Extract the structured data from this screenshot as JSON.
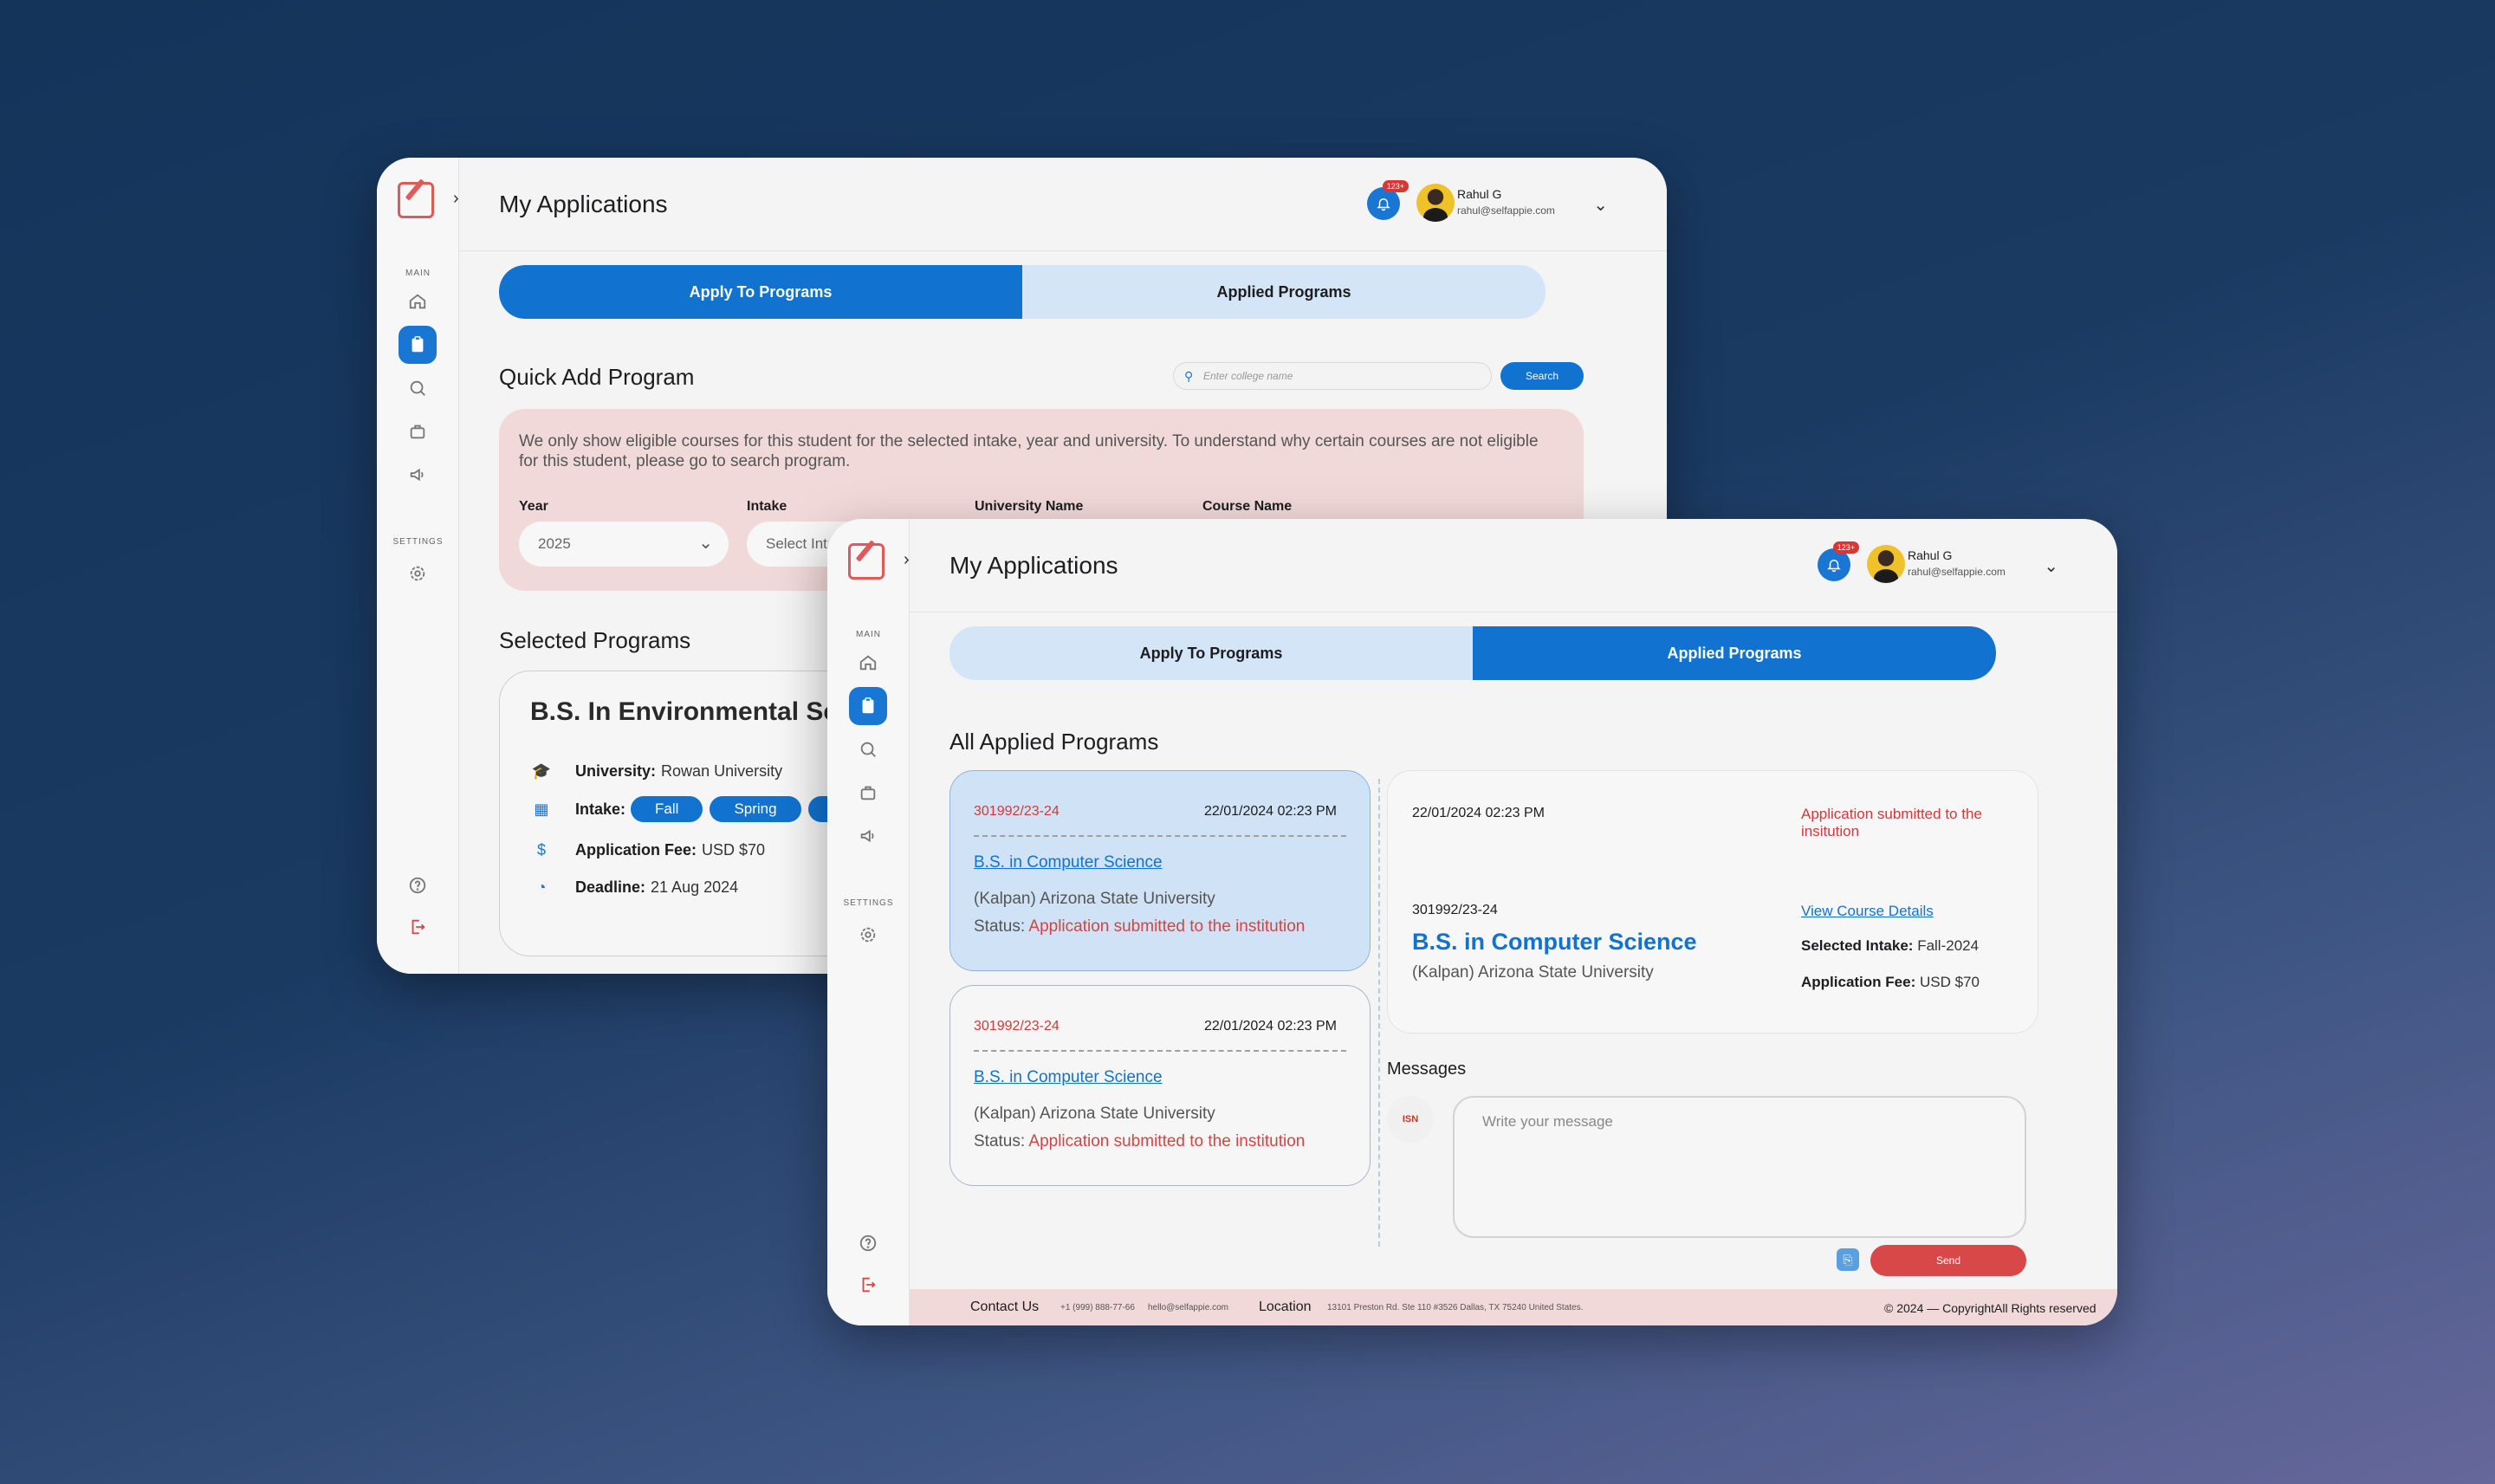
{
  "back": {
    "title": "My Applications",
    "badge": "123+",
    "user": {
      "name": "Rahul G",
      "email": "rahul@selfappie.com"
    },
    "sidebar": {
      "main_label": "MAIN",
      "settings_label": "SETTINGS"
    },
    "tabs": [
      "Apply To Programs",
      "Applied Programs"
    ],
    "quick_add_title": "Quick Add Program",
    "search": {
      "placeholder": "Enter college name",
      "button": "Search"
    },
    "notice": "We only show eligible courses for this student for the selected intake, year and university. To understand why certain courses are not eligible for this student, please go to search program.",
    "filters": {
      "year_label": "Year",
      "year_value": "2025",
      "intake_label": "Intake",
      "intake_value": "Select Int",
      "university_label": "University Name",
      "course_label": "Course Name"
    },
    "selected_title": "Selected Programs",
    "program": {
      "title": "B.S. In Environmental Sci",
      "university_label": "University:",
      "university": "Rowan University",
      "intake_label": "Intake:",
      "intakes": [
        "Fall",
        "Spring",
        "A"
      ],
      "fee_label": "Application Fee:",
      "fee": "USD $70",
      "deadline_label": "Deadline:",
      "deadline": "21 Aug 2024"
    }
  },
  "front": {
    "title": "My Applications",
    "badge": "123+",
    "user": {
      "name": "Rahul G",
      "email": "rahul@selfappie.com"
    },
    "sidebar": {
      "main_label": "MAIN",
      "settings_label": "SETTINGS"
    },
    "tabs": [
      "Apply To Programs",
      "Applied Programs"
    ],
    "all_applied_title": "All Applied Programs",
    "applications": [
      {
        "id": "301992/23-24",
        "datetime": "22/01/2024 02:23 PM",
        "course": "B.S. in Computer Science",
        "university": "(Kalpan) Arizona State University",
        "status_label": "Status:",
        "status": "Application submitted to the institution"
      },
      {
        "id": "301992/23-24",
        "datetime": "22/01/2024 02:23 PM",
        "course": "B.S. in Computer Science",
        "university": "(Kalpan) Arizona State University",
        "status_label": "Status:",
        "status": "Application submitted to the institution"
      }
    ],
    "detail": {
      "datetime": "22/01/2024 02:23 PM",
      "status": "Application submitted to the insitution",
      "id": "301992/23-24",
      "course": "B.S. in Computer Science",
      "university": "(Kalpan) Arizona State University",
      "link": "View Course Details",
      "intake_label": "Selected Intake:",
      "intake": "Fall-2024",
      "fee_label": "Application Fee:",
      "fee": "USD $70"
    },
    "messages": {
      "label": "Messages",
      "avatar_text": "ISN",
      "placeholder": "Write your message",
      "send": "Send"
    },
    "footer": {
      "contact_label": "Contact Us",
      "phone": "+1 (999) 888-77-66",
      "email": "hello@selfappie.com",
      "location_label": "Location",
      "address": "13101 Preston Rd. Ste 110 #3526 Dallas, TX 75240 United States.",
      "copyright": "© 2024 — CopyrightAll Rights reserved"
    }
  },
  "colors": {
    "primary": "#1272cf",
    "danger": "#d84848",
    "notice_bg": "#f2d9d9"
  }
}
